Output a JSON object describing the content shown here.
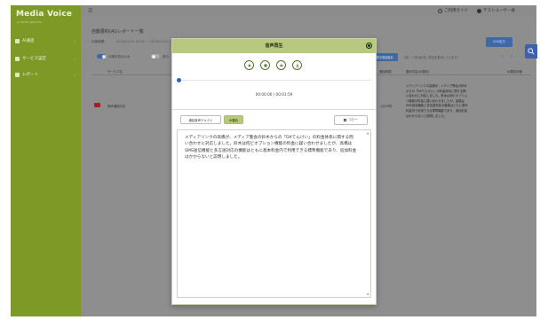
{
  "brand": {
    "name": "Media Voice",
    "subtitle": "AI VOICE ANALYSIS"
  },
  "sidebar": {
    "items": [
      {
        "label": "AI通話",
        "icon": "home-icon"
      },
      {
        "label": "サービス設定",
        "icon": "settings-icon"
      },
      {
        "label": "レポート",
        "icon": "report-icon"
      }
    ]
  },
  "header": {
    "guide_label": "ご利用ガイド",
    "user_label": "テストユーザー様"
  },
  "page": {
    "title": "自動要約(AI)レポート一覧",
    "condition_label": "対象期間",
    "condition_value": "2023/01/01 00:00 ~ 2023/01/31 23:59",
    "csv_label": "CSV出力",
    "toggles": [
      {
        "label": "AI要約表示のみ",
        "on": true
      },
      {
        "label": "表示",
        "on": false
      }
    ],
    "display_button": "表示項目設定",
    "pagination_text": "1件 ~ 1件(全1件 / 件目を表示しています)",
    "prev_icon": "chevron-left-icon",
    "next_icon": "chevron-right-icon"
  },
  "table": {
    "headers": [
      "サービス名",
      "通話時間",
      "要約内容(AI要約)",
      "AI要約評価"
    ],
    "rows": [
      {
        "service": "音声通話対応",
        "time": "1分59秒",
        "summary": "メディアリンクの高橋が、メディア警会の鈴木からの「DXてんけい」の料金体系に関する問い合わせに対応しました。鈴木は何ビオプション機能の料金に疑い合わせましたが、高橋はSMS送信機能と多言語対応の機能はともに基本料金内で利用できる標準機能であり、追加料金はかからないと説明しました。"
      }
    ]
  },
  "modal": {
    "title": "音声再生",
    "close_icon": "close-circle-icon",
    "controls": [
      {
        "name": "play-button",
        "icon": "play-icon"
      },
      {
        "name": "stop-button",
        "icon": "stop-icon"
      },
      {
        "name": "volume-button",
        "icon": "volume-icon"
      },
      {
        "name": "download-button",
        "icon": "download-icon"
      }
    ],
    "progress": 0.0,
    "time_display": "00:00:00 / 00:01:59",
    "tabs": [
      {
        "label": "通話音声テキスト",
        "active": false
      },
      {
        "label": "AI要約",
        "active": true
      }
    ],
    "copy_label": "コピー",
    "summary_text": "メディアリンクの高橋が、メディア警会の鈴木からの「DXてんけい」の料金体系に関する問い合わせに対応しました。鈴木は何ビオプション機能の料金に疑い合わせましたが、高橋はSMS送信機能と多言語対応の機能はともに基本料金内で利用できる標準機能であり、追加料金はかからないと説明しました。"
  },
  "colors": {
    "sidebar": "#7d9a26",
    "modal_header": "#b6c97f",
    "accent_blue": "#2f62c5",
    "button_blue": "#3f68a6",
    "row_icon": "#a32020"
  }
}
